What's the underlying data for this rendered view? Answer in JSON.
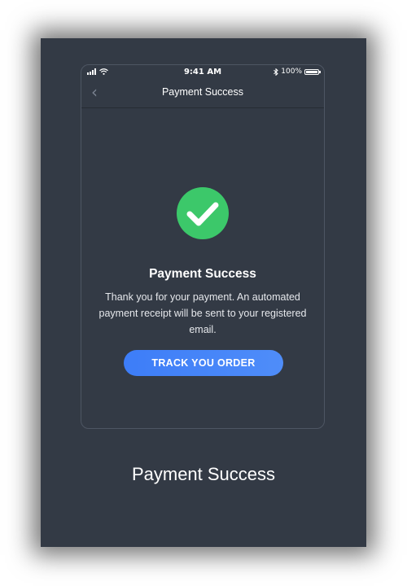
{
  "statusbar": {
    "time": "9:41 AM",
    "battery": "100%",
    "battery_level": 1.0
  },
  "navbar": {
    "back_icon": "chevron-left-icon",
    "title": "Payment Success"
  },
  "content": {
    "status_icon": "check-circle-icon",
    "title": "Payment Success",
    "message": "Thank you for your payment. An automated payment receipt will be sent to your registered email.",
    "button_label": "TRACK YOU ORDER"
  },
  "caption": "Payment Success",
  "colors": {
    "background": "#333a45",
    "success": "#3cc86a",
    "button": "#4a8af9",
    "text": "#ffffff"
  }
}
